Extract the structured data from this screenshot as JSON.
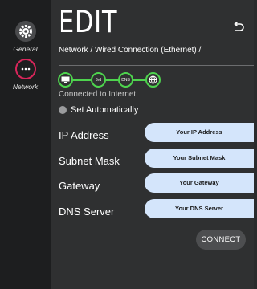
{
  "sidebar": {
    "items": [
      {
        "label": "General",
        "icon": "gear-icon"
      },
      {
        "label": "Network",
        "icon": "ellipsis-icon"
      }
    ]
  },
  "header": {
    "title": "EDIT",
    "breadcrumb": "Network / Wired Connection (Ethernet) /"
  },
  "steps": {
    "router_label": "3rd",
    "dns_label": "DNS",
    "status": "Connected to Internet"
  },
  "auto": {
    "label": "Set Automatically"
  },
  "fields": {
    "ip": {
      "label": "IP Address",
      "value": "Your IP Address"
    },
    "subnet": {
      "label": "Subnet Mask",
      "value": "Your Subnet Mask"
    },
    "gateway": {
      "label": "Gateway",
      "value": "Your Gateway"
    },
    "dns": {
      "label": "DNS Server",
      "value": "Your DNS Server"
    }
  },
  "actions": {
    "connect": "CONNECT"
  },
  "colors": {
    "accent_green": "#4ed34e",
    "network_ring": "#d9265b",
    "field_bg": "#d4e5fb"
  }
}
